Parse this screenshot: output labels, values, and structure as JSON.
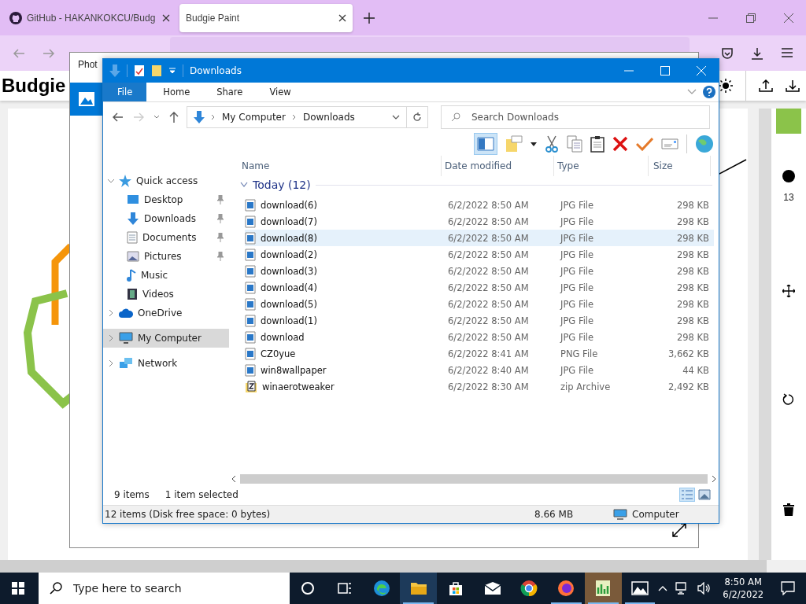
{
  "browser": {
    "tabs": [
      {
        "title": "GitHub - HAKANKOKCU/Budg",
        "selected": false,
        "kind": "github"
      },
      {
        "title": "Budgie Paint",
        "selected": true,
        "kind": "page"
      }
    ]
  },
  "app": {
    "title": "Budgie",
    "brush_size": "13"
  },
  "photos_window": {
    "title": "Phot"
  },
  "explorer": {
    "title": "Downloads",
    "ribbon_tabs": [
      {
        "label": "File",
        "selected": true
      },
      {
        "label": "Home",
        "selected": false
      },
      {
        "label": "Share",
        "selected": false
      },
      {
        "label": "View",
        "selected": false
      }
    ],
    "path": [
      "My Computer",
      "Downloads"
    ],
    "search": {
      "placeholder": "Search Downloads"
    },
    "preview_pane_on": true,
    "nav": [
      {
        "label": "Quick access",
        "kind": "star",
        "expanded": true,
        "selected": false,
        "children": [
          {
            "label": "Desktop",
            "kind": "desktop",
            "pinned": true,
            "selected": false
          },
          {
            "label": "Downloads",
            "kind": "downloads",
            "pinned": true,
            "selected": false
          },
          {
            "label": "Documents",
            "kind": "documents",
            "pinned": true,
            "selected": false
          },
          {
            "label": "Pictures",
            "kind": "pictures",
            "pinned": true,
            "selected": false
          },
          {
            "label": "Music",
            "kind": "music",
            "pinned": false,
            "selected": false
          },
          {
            "label": "Videos",
            "kind": "videos",
            "pinned": false,
            "selected": false
          }
        ]
      },
      {
        "label": "OneDrive",
        "kind": "cloud",
        "expanded": false,
        "selected": false
      },
      {
        "label": "My Computer",
        "kind": "computer",
        "expanded": false,
        "selected": true
      },
      {
        "label": "Network",
        "kind": "network",
        "expanded": false,
        "selected": false
      }
    ],
    "columns": [
      "Name",
      "Date modified",
      "Type",
      "Size"
    ],
    "group": {
      "label": "Today (12)",
      "expanded": true
    },
    "files": [
      {
        "name": "download(6)",
        "date": "6/2/2022 8:50 AM",
        "type": "JPG File",
        "size": "298 KB",
        "kind": "image",
        "selected": false
      },
      {
        "name": "download(7)",
        "date": "6/2/2022 8:50 AM",
        "type": "JPG File",
        "size": "298 KB",
        "kind": "image",
        "selected": false
      },
      {
        "name": "download(8)",
        "date": "6/2/2022 8:50 AM",
        "type": "JPG File",
        "size": "298 KB",
        "kind": "image",
        "selected": true
      },
      {
        "name": "download(2)",
        "date": "6/2/2022 8:50 AM",
        "type": "JPG File",
        "size": "298 KB",
        "kind": "image",
        "selected": false
      },
      {
        "name": "download(3)",
        "date": "6/2/2022 8:50 AM",
        "type": "JPG File",
        "size": "298 KB",
        "kind": "image",
        "selected": false
      },
      {
        "name": "download(4)",
        "date": "6/2/2022 8:50 AM",
        "type": "JPG File",
        "size": "298 KB",
        "kind": "image",
        "selected": false
      },
      {
        "name": "download(5)",
        "date": "6/2/2022 8:50 AM",
        "type": "JPG File",
        "size": "298 KB",
        "kind": "image",
        "selected": false
      },
      {
        "name": "download(1)",
        "date": "6/2/2022 8:50 AM",
        "type": "JPG File",
        "size": "298 KB",
        "kind": "image",
        "selected": false
      },
      {
        "name": "download",
        "date": "6/2/2022 8:50 AM",
        "type": "JPG File",
        "size": "298 KB",
        "kind": "image",
        "selected": false
      },
      {
        "name": "CZ0yue",
        "date": "6/2/2022 8:41 AM",
        "type": "PNG File",
        "size": "3,662 KB",
        "kind": "image",
        "selected": false
      },
      {
        "name": "win8wallpaper",
        "date": "6/2/2022 8:40 AM",
        "type": "JPG File",
        "size": "44 KB",
        "kind": "image",
        "selected": false
      },
      {
        "name": "winaerotweaker",
        "date": "6/2/2022 8:30 AM",
        "type": "zip Archive",
        "size": "2,492 KB",
        "kind": "zip",
        "selected": false
      }
    ],
    "status": {
      "items": "9 items",
      "selection": "1 item selected",
      "details_view": true
    },
    "details_bar": {
      "summary": "12 items (Disk free space: 0 bytes)",
      "size": "8.66 MB",
      "location": "Computer"
    }
  },
  "taskbar": {
    "search": {
      "placeholder": "Type here to search"
    },
    "apps": [
      {
        "kind": "cortana",
        "running": false,
        "focused": false
      },
      {
        "kind": "taskview",
        "running": false,
        "focused": false
      },
      {
        "kind": "edge",
        "running": false,
        "focused": false
      },
      {
        "kind": "explorer",
        "running": true,
        "focused": true
      },
      {
        "kind": "store",
        "running": false,
        "focused": false
      },
      {
        "kind": "mail",
        "running": false,
        "focused": false
      },
      {
        "kind": "chrome",
        "running": false,
        "focused": false
      },
      {
        "kind": "firefox",
        "running": true,
        "focused": false
      },
      {
        "kind": "paint",
        "running": true,
        "focused": true
      },
      {
        "kind": "photos",
        "running": true,
        "focused": false
      }
    ],
    "time": "8:50 AM",
    "date": "6/2/2022"
  }
}
